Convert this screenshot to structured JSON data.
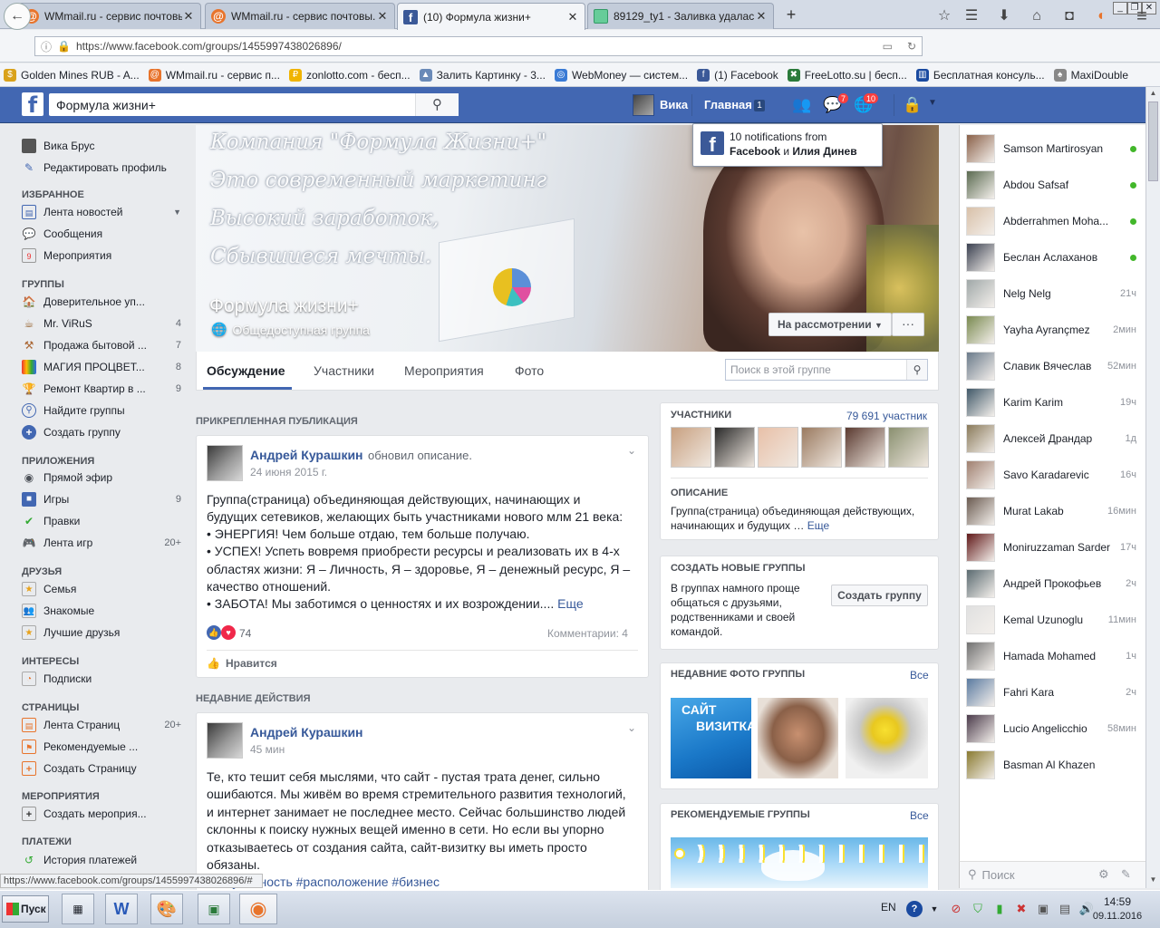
{
  "browser": {
    "tabs": [
      {
        "title": "WMmail.ru - сервис почтовы...",
        "icon": "wmmail"
      },
      {
        "title": "WMmail.ru - сервис почтовы...",
        "icon": "wmmail"
      },
      {
        "title": "(10) Формула жизни+",
        "icon": "facebook"
      },
      {
        "title": "89129_ty1 - Заливка удалас...",
        "icon": "generic"
      }
    ],
    "url": "https://www.facebook.com/groups/1455997438026896/",
    "new_tab": "+",
    "bookmarks": [
      "Golden Mines RUB - A...",
      "WMmail.ru - сервис п...",
      "zonlotto.com - бесп...",
      "Залить Картинку - 3...",
      "WebMoney — систем...",
      "(1) Facebook",
      "FreeLotto.su | бесп...",
      "Бесплатная консуль...",
      "MaxiDouble"
    ],
    "status_url": "https://www.facebook.com/groups/1455997438026896/#"
  },
  "header": {
    "search_value": "Формула жизни+",
    "user_name": "Вика",
    "home_label": "Главная",
    "home_count": "1",
    "messages_badge": "7",
    "notifications_badge": "10"
  },
  "notification_popup": {
    "line1": "10 notifications from",
    "from1": "Facebook",
    "and": " и ",
    "from2": "Илия Динев"
  },
  "left_nav": {
    "profile_name": "Вика Брус",
    "edit_profile": "Редактировать профиль",
    "sections": {
      "favorites": "ИЗБРАННОЕ",
      "groups": "ГРУППЫ",
      "apps": "ПРИЛОЖЕНИЯ",
      "friends": "ДРУЗЬЯ",
      "interests": "ИНТЕРЕСЫ",
      "pages": "СТРАНИЦЫ",
      "events": "МЕРОПРИЯТИЯ",
      "payments": "ПЛАТЕЖИ"
    },
    "favorites": [
      {
        "label": "Лента новостей",
        "count": ""
      },
      {
        "label": "Сообщения",
        "count": ""
      },
      {
        "label": "Мероприятия",
        "count": ""
      }
    ],
    "groups": [
      {
        "label": "Доверительное уп...",
        "count": ""
      },
      {
        "label": "Mr. ViRuS",
        "count": "4"
      },
      {
        "label": "Продажа бытовой ...",
        "count": "7"
      },
      {
        "label": "МАГИЯ ПРОЦВЕТ...",
        "count": "8"
      },
      {
        "label": "Ремонт Квартир в ...",
        "count": "9"
      },
      {
        "label": "Найдите группы",
        "count": ""
      },
      {
        "label": "Создать группу",
        "count": ""
      }
    ],
    "apps": [
      {
        "label": "Прямой эфир",
        "count": ""
      },
      {
        "label": "Игры",
        "count": "9"
      },
      {
        "label": "Правки",
        "count": ""
      },
      {
        "label": "Лента игр",
        "count": "20+"
      }
    ],
    "friends": [
      {
        "label": "Семья",
        "count": ""
      },
      {
        "label": "Знакомые",
        "count": ""
      },
      {
        "label": "Лучшие друзья",
        "count": ""
      }
    ],
    "interests": [
      {
        "label": "Подписки",
        "count": ""
      }
    ],
    "pages": [
      {
        "label": "Лента Страниц",
        "count": "20+"
      },
      {
        "label": "Рекомендуемые ...",
        "count": ""
      },
      {
        "label": "Создать Страницу",
        "count": ""
      }
    ],
    "events": [
      {
        "label": "Создать мероприя...",
        "count": ""
      }
    ],
    "payments": [
      {
        "label": "История платежей",
        "count": ""
      }
    ]
  },
  "cover": {
    "lines": [
      "Компания \"Формула Жизни+\"",
      "Это современный маркетинг",
      "Высокий заработок,",
      "Сбывшиеся мечты."
    ],
    "group_name": "Формула жизни+",
    "privacy": "Общедоступная группа",
    "pending_label": "На рассмотрении",
    "more_label": "···"
  },
  "group_tabs": {
    "items": [
      "Обсуждение",
      "Участники",
      "Мероприятия",
      "Фото"
    ],
    "active": "Обсуждение",
    "search_placeholder": "Поиск в этой группе"
  },
  "pinned": {
    "header": "ПРИКРЕПЛЕННАЯ ПУБЛИКАЦИЯ",
    "author": "Андрей Курашкин",
    "action": "обновил описание.",
    "date": "24 июня 2015 г.",
    "lines": [
      "Группа(страница) объединяющая действующих, начинающих и",
      "будущих сетевиков, желающих быть участниками нового млм 21 века:",
      "• ЭНЕРГИЯ! Чем больше отдаю, тем больше получаю.",
      "• УСПЕХ! Успеть вовремя приобрести ресурсы и реализовать их в 4-х",
      "областях жизни: Я – Личность, Я – здоровье, Я – денежный ресурс, Я –",
      "качество отношений.",
      "• ЗАБОТА! Мы заботимся о ценностях и их возрождении...."
    ],
    "more": "Еще",
    "reactions": "74",
    "comments": "Комментарии: 4",
    "like": "Нравится"
  },
  "recent": {
    "header": "НЕДАВНИЕ ДЕЙСТВИЯ",
    "author": "Андрей Курашкин",
    "time": "45 мин",
    "lines": [
      "Те, кто тешит себя мыслями, что сайт - пустая трата денег, сильно",
      "ошибаются. Мы живём во время стремительного развития технологий,",
      "и интернет занимает не последнее место. Сейчас большинство людей",
      "склонны к поиску нужных вещей именно в сети. Но если вы упорно",
      "отказываетесь от создания сайта, сайт-визитку вы иметь просто",
      "обязаны."
    ],
    "hashtags": "#актуальность #расположение #бизнес"
  },
  "members": {
    "header": "УЧАСТНИКИ",
    "count": "79 691 участник",
    "thumb_colors": [
      "#c8a080",
      "#2a2a2a",
      "#e8c0a8",
      "#9a7a60",
      "#5a3a30",
      "#8a9070"
    ]
  },
  "description": {
    "header": "ОПИСАНИЕ",
    "text1": "Группа(страница) объединяющая действующих,",
    "text2": "начинающих и будущих …",
    "more": "Еще"
  },
  "create_groups": {
    "header": "СОЗДАТЬ НОВЫЕ ГРУППЫ",
    "lines": [
      "В группах намного проще",
      "общаться с друзьями,",
      "родственниками и своей",
      "командой."
    ],
    "button": "Создать группу"
  },
  "recent_photos": {
    "header": "НЕДАВНИЕ ФОТО ГРУППЫ",
    "all": "Все",
    "photo1_line1": "САЙТ",
    "photo1_line2": "ВИЗИТКА"
  },
  "recommended": {
    "header": "РЕКОМЕНДУЕМЫЕ ГРУППЫ",
    "all": "Все"
  },
  "chat": {
    "contacts": [
      {
        "name": "Samson Martirosyan",
        "status": "online",
        "time": ""
      },
      {
        "name": "Abdou Safsaf",
        "status": "online",
        "time": ""
      },
      {
        "name": "Abderrahmen Moha...",
        "status": "online",
        "time": ""
      },
      {
        "name": "Беслан Аслаханов",
        "status": "online",
        "time": ""
      },
      {
        "name": "Nelg Nelg",
        "status": "",
        "time": "21ч"
      },
      {
        "name": "Yayha Ayrançmez",
        "status": "",
        "time": "2мин"
      },
      {
        "name": "Славик Вячеслав",
        "status": "",
        "time": "52мин"
      },
      {
        "name": "Karim Karim",
        "status": "",
        "time": "19ч"
      },
      {
        "name": "Алексей Драндар",
        "status": "",
        "time": "1д"
      },
      {
        "name": "Savo Karadarevic",
        "status": "",
        "time": "16ч"
      },
      {
        "name": "Murat Lakab",
        "status": "",
        "time": "16мин"
      },
      {
        "name": "Moniruzzaman Sarder",
        "status": "",
        "time": "17ч"
      },
      {
        "name": "Андрей Прокофьев",
        "status": "",
        "time": "2ч"
      },
      {
        "name": "Kemal Uzunoglu",
        "status": "",
        "time": "11мин"
      },
      {
        "name": "Hamada Mohamed",
        "status": "",
        "time": "1ч"
      },
      {
        "name": "Fahri Kara",
        "status": "",
        "time": "2ч"
      },
      {
        "name": "Lucio Angelicchio",
        "status": "",
        "time": "58мин"
      },
      {
        "name": "Basman Al Khazen",
        "status": "",
        "time": ""
      }
    ],
    "pic_colors": [
      "#8a6048",
      "#5a6a50",
      "#d8c0a8",
      "#3a4050",
      "#a0a8a8",
      "#7a8a50",
      "#6a7a8a",
      "#405868",
      "#8a7a5a",
      "#a08070",
      "#6a5a50",
      "#601818",
      "#5a6a70",
      "#e0e0e0",
      "#707070",
      "#5a7aa0",
      "#4a3a4a",
      "#8a7a30"
    ],
    "search_placeholder": "Поиск"
  },
  "taskbar": {
    "start": "Пуск",
    "lang": "EN",
    "time": "14:59",
    "date": "09.11.2016"
  }
}
